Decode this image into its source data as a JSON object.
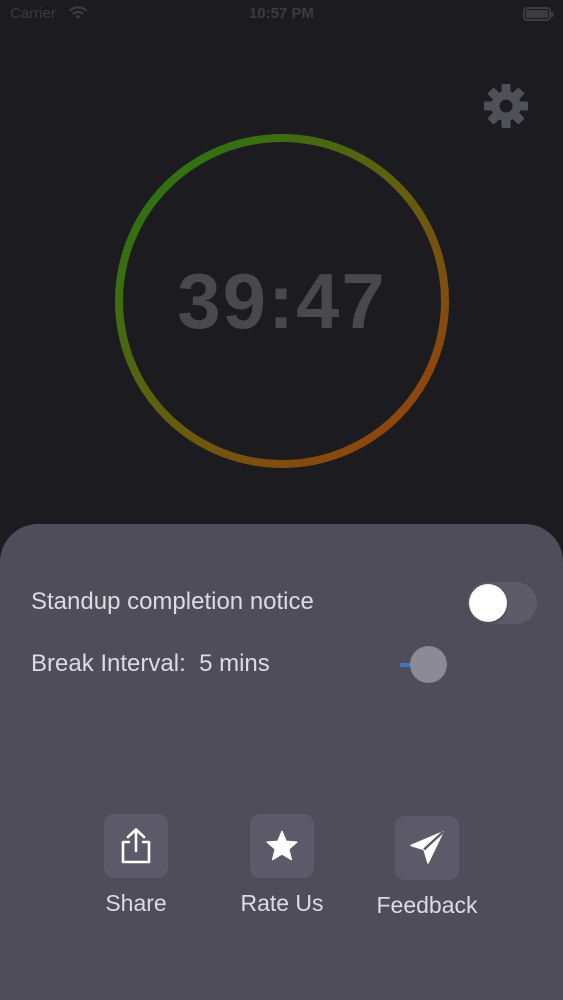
{
  "status_bar": {
    "carrier": "Carrier",
    "time": "10:57 PM",
    "wifi_icon": "wifi-icon",
    "battery_icon": "battery-icon",
    "battery_level": 1.0
  },
  "header": {
    "settings_icon": "gear-icon"
  },
  "timer": {
    "display": "39:47",
    "ring_colors": [
      "#1b8a10",
      "#b5420b"
    ]
  },
  "sheet": {
    "notice_label": "Standup completion notice",
    "notice_enabled": false,
    "interval_label": "Break Interval:  5 mins",
    "interval_slider_level": 0.05,
    "actions": [
      {
        "label": "Share",
        "icon": "share-icon"
      },
      {
        "label": "Rate Us",
        "icon": "star-icon"
      },
      {
        "label": "Feedback",
        "icon": "paper-plane-icon"
      }
    ]
  },
  "colors": {
    "background": "#1c1b20",
    "sheet": "#504d5b",
    "text": "#dcdbe2",
    "timer_text": "#49484d",
    "slider_accent": "#3b76c9"
  }
}
